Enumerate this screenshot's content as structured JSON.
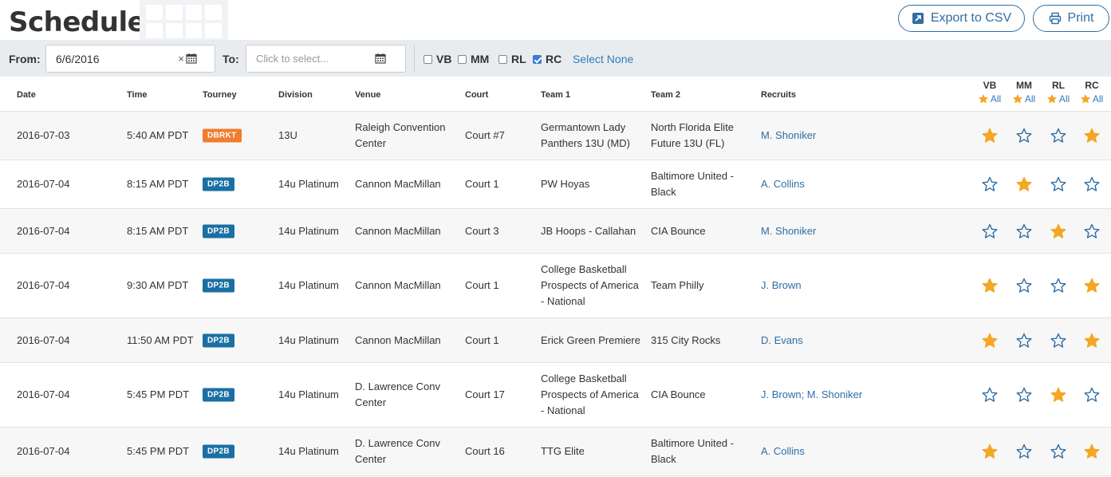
{
  "header": {
    "title": "Schedule",
    "export_label": "Export to CSV",
    "print_label": "Print"
  },
  "filters": {
    "from_label": "From:",
    "from_value": "6/6/2016",
    "to_label": "To:",
    "to_placeholder": "Click to select...",
    "clear_glyph": "×",
    "checkboxes": [
      {
        "label": "VB",
        "checked": false
      },
      {
        "label": "MM",
        "checked": false
      },
      {
        "label": "RL",
        "checked": false
      },
      {
        "label": "RC",
        "checked": true
      }
    ],
    "select_none": "Select None"
  },
  "columns": [
    "Date",
    "Time",
    "Tourney",
    "Division",
    "Venue",
    "Court",
    "Team 1",
    "Team 2",
    "Recruits"
  ],
  "recruiter_columns": [
    {
      "code": "VB",
      "all": "All"
    },
    {
      "code": "MM",
      "all": "All"
    },
    {
      "code": "RL",
      "all": "All"
    },
    {
      "code": "RC",
      "all": "All"
    }
  ],
  "colors": {
    "accent": "#2f6ea5",
    "star": "#f5a623",
    "badge_dbrkt": "#f07c30",
    "badge_dp2b": "#1a6fa3"
  },
  "rows": [
    {
      "date": "2016-07-03",
      "time": "5:40 AM PDT",
      "tourney": "DBRKT",
      "badge": "orange",
      "division": "13U",
      "venue": "Raleigh Convention Center",
      "court": "Court #7",
      "team1": "Germantown Lady Panthers 13U (MD)",
      "team2": "North Florida Elite Future 13U (FL)",
      "recruits": "M. Shoniker",
      "stars": [
        true,
        false,
        false,
        true
      ]
    },
    {
      "date": "2016-07-04",
      "time": "8:15 AM PDT",
      "tourney": "DP2B",
      "badge": "blue",
      "division": "14u Platinum",
      "venue": "Cannon MacMillan",
      "court": "Court 1",
      "team1": "PW Hoyas",
      "team2": "Baltimore United - Black",
      "recruits": "A. Collins",
      "stars": [
        false,
        true,
        false,
        false
      ]
    },
    {
      "date": "2016-07-04",
      "time": "8:15 AM PDT",
      "tourney": "DP2B",
      "badge": "blue",
      "division": "14u Platinum",
      "venue": "Cannon MacMillan",
      "court": "Court 3",
      "team1": "JB Hoops - Callahan",
      "team2": "CIA Bounce",
      "recruits": "M. Shoniker",
      "stars": [
        false,
        false,
        true,
        false
      ]
    },
    {
      "date": "2016-07-04",
      "time": "9:30 AM PDT",
      "tourney": "DP2B",
      "badge": "blue",
      "division": "14u Platinum",
      "venue": "Cannon MacMillan",
      "court": "Court 1",
      "team1": "College Basketball Prospects of America - National",
      "team2": "Team Philly",
      "recruits": "J. Brown",
      "stars": [
        true,
        false,
        false,
        true
      ]
    },
    {
      "date": "2016-07-04",
      "time": "11:50 AM PDT",
      "tourney": "DP2B",
      "badge": "blue",
      "division": "14u Platinum",
      "venue": "Cannon MacMillan",
      "court": "Court 1",
      "team1": "Erick Green Premiere",
      "team2": "315 City Rocks",
      "recruits": "D. Evans",
      "stars": [
        true,
        false,
        false,
        true
      ]
    },
    {
      "date": "2016-07-04",
      "time": "5:45 PM PDT",
      "tourney": "DP2B",
      "badge": "blue",
      "division": "14u Platinum",
      "venue": "D. Lawrence Conv Center",
      "court": "Court 17",
      "team1": "College Basketball Prospects of America - National",
      "team2": "CIA Bounce",
      "recruits": "J. Brown; M. Shoniker",
      "stars": [
        false,
        false,
        true,
        false
      ]
    },
    {
      "date": "2016-07-04",
      "time": "5:45 PM PDT",
      "tourney": "DP2B",
      "badge": "blue",
      "division": "14u Platinum",
      "venue": "D. Lawrence Conv Center",
      "court": "Court 16",
      "team1": "TTG Elite",
      "team2": "Baltimore United - Black",
      "recruits": "A. Collins",
      "stars": [
        true,
        false,
        false,
        true
      ]
    }
  ]
}
